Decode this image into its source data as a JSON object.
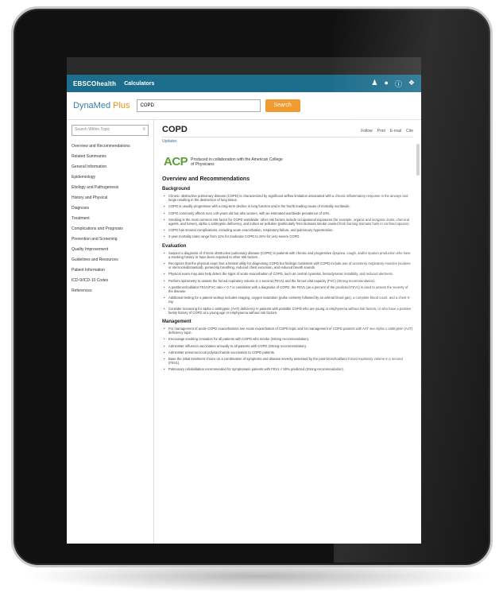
{
  "header": {
    "logo": "EBSCOhealth",
    "nav": "Calculators"
  },
  "search": {
    "brand": "DynaMed",
    "brand_suffix": "Plus",
    "value": "COPD",
    "button": "Search"
  },
  "sidebar": {
    "filter_placeholder": "Search Within Topic",
    "items": [
      "Overview and Recommendations",
      "Related Summaries",
      "General Information",
      "Epidemiology",
      "Etiology and Pathogenesis",
      "History and Physical",
      "Diagnosis",
      "Treatment",
      "Complications and Prognosis",
      "Prevention and Screening",
      "Quality Improvement",
      "Guidelines and Resources",
      "Patient Information",
      "ICD-9/ICD-10 Codes",
      "References"
    ]
  },
  "main": {
    "title": "COPD",
    "tools": [
      "Follow",
      "Print",
      "E-mail",
      "Cite"
    ],
    "updates": "Updates",
    "acp_mark": "ACP",
    "acp_text": "Produced in collaboration with the American College of Physicians",
    "section": "Overview and Recommendations",
    "background_heading": "Background",
    "background": [
      "Chronic obstructive pulmonary disease (COPD) is characterized by significant airflow limitation associated with a chronic inflammatory response in the airways and lungs resulting in the destruction of lung tissue.",
      "COPD is usually progressive with a long-term decline in lung function and is the fourth leading cause of mortality worldwide.",
      "COPD commonly affects men ≥40 years old but also women, with an estimated worldwide prevalence of 10%.",
      "Smoking is the most common risk factor for COPD worldwide; other risk factors include occupational exposures (for example, organic and inorganic dusts, chemical agents, and fumes), alpha-1 antitrypsin deficiency, and indoor air pollution (particularly from biomass smoke caused from burning biomass fuels in confined spaces).",
      "COPD has several complications, including acute exacerbation, respiratory failure, and pulmonary hypertension.",
      "3-year mortality rates range from 11% for moderate COPD to 24% for very severe COPD."
    ],
    "evaluation_heading": "Evaluation",
    "evaluation": [
      "Suspect a diagnosis of chronic obstructive pulmonary disease (COPD) in patients with chronic and progressive dyspnea, cough, and/or sputum production who have a smoking history or have been exposed to other risk factors.",
      "Recognize that the physical exam has a limited utility for diagnosing COPD but findings consistent with COPD include use of accessory respiratory muscles (scalene or sternocleidomastoid), pursed-lip breathing, reduced chest excursion, and reduced breath sounds.",
      "Physical exam may also help detect the signs of acute exacerbation of COPD, such as central cyanosis, hemodynamic instability, and reduced alertness.",
      "Perform spirometry to assess the forced expiratory volume in 1 second (FEV1) and the forced vital capacity (FVC) (Strong recommendation).",
      "A postbronchodilator FEV1/FVC ratio < 0.7 is consistent with a diagnosis of COPD; the FEV1 (as a percent of the predicted FEV1) is used to assess the severity of the disease.",
      "Additional testing for a patient workup includes imaging, oxygen saturation (pulse oximetry followed by an arterial blood gas), a complete blood count, and a chest X-ray.",
      "Consider screening for alpha-1 antitrypsin (AAT) deficiency in patients with possible COPD who are young or emphysema without risk factors, or who have a positive family history of COPD at a young age or emphysema without risk factors."
    ],
    "management_heading": "Management",
    "management": [
      "For management of acute COPD exacerbations see Acute exacerbation of COPD topic and for management of COPD patients with AAT see Alpha-1 antitrypsin (AAT) deficiency topic.",
      "Encourage smoking cessation for all patients with COPD who smoke (Strong recommendation).",
      "Administer influenza vaccination annually to all patients with COPD (Strong recommendation).",
      "Administer pneumococcal polysaccharide vaccination to COPD patients.",
      "Base the initial treatment choice on a combination of symptoms and disease severity assessed by the post-bronchodilator forced expiratory volume in 1 second (FEV1).",
      "Pulmonary rehabilitation recommended for symptomatic patients with FEV1 < 50% predicted (Strong recommendation)."
    ]
  }
}
